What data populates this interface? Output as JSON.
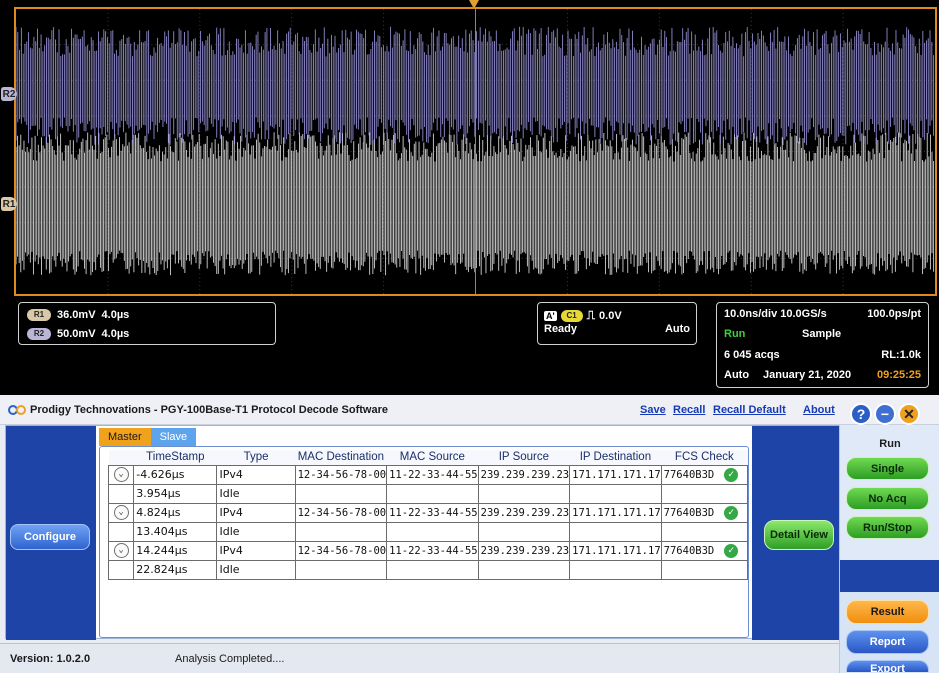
{
  "scope": {
    "markers": {
      "r2": "R2",
      "r1": "R1"
    },
    "channels": [
      {
        "tag": "R1",
        "scale": "36.0mV",
        "time": "4.0µs",
        "color": "#d9c9a8"
      },
      {
        "tag": "R2",
        "scale": "50.0mV",
        "time": "4.0µs",
        "color": "#b9b6d6"
      }
    ],
    "trigger": {
      "source_tag": "A'",
      "channel": "C1",
      "level": "0.0V",
      "state": "Ready",
      "mode": "Auto"
    },
    "acquisition": {
      "horizontal": "10.0ns/div 10.0GS/s",
      "per_point": "100.0ps/pt",
      "run_state": "Run",
      "sample_mode": "Sample",
      "acqs": "6 045 acqs",
      "record_length": "RL:1.0k",
      "trigger_mode": "Auto",
      "date": "January 21, 2020",
      "time": "09:25:25"
    },
    "colors": {
      "frame": "#e08a1e",
      "r1_wave": "#e8e8e8",
      "r2_wave": "#a9a3f2",
      "run": "#3cd23c",
      "time": "#f0a020"
    }
  },
  "app": {
    "title": "Prodigy Technovations - PGY-100Base-T1  Protocol Decode Software",
    "links": {
      "save": "Save",
      "recall": "Recall",
      "recall_default": "Recall Default",
      "about": "About"
    },
    "window_buttons": {
      "help": "?",
      "minimize": "−",
      "close": "✕"
    },
    "tabs": {
      "master": "Master",
      "slave": "Slave"
    },
    "buttons": {
      "configure": "Configure",
      "detail_view": "Detail View",
      "single": "Single",
      "no_acq": "No Acq",
      "run_stop": "Run/Stop",
      "result": "Result",
      "report": "Report",
      "export": "Export"
    },
    "run_label": "Run",
    "table": {
      "columns": [
        "",
        "TimeStamp",
        "Type",
        "MAC Destination",
        "MAC Source",
        "IP Source",
        "IP Destination",
        "FCS Check"
      ],
      "rows": [
        {
          "expand": true,
          "timestamp": "-4.626µs",
          "type": "IPv4",
          "mac_dst": "12-34-56-78-00",
          "mac_src": "11-22-33-44-55",
          "ip_src": "239.239.239.23",
          "ip_dst": "171.171.171.17",
          "fcs": "77640B3D",
          "fcs_ok": true
        },
        {
          "expand": false,
          "timestamp": "3.954µs",
          "type": "Idle",
          "mac_dst": "",
          "mac_src": "",
          "ip_src": "",
          "ip_dst": "",
          "fcs": "",
          "fcs_ok": false
        },
        {
          "expand": true,
          "timestamp": "4.824µs",
          "type": "IPv4",
          "mac_dst": "12-34-56-78-00",
          "mac_src": "11-22-33-44-55",
          "ip_src": "239.239.239.23",
          "ip_dst": "171.171.171.17",
          "fcs": "77640B3D",
          "fcs_ok": true
        },
        {
          "expand": false,
          "timestamp": "13.404µs",
          "type": "Idle",
          "mac_dst": "",
          "mac_src": "",
          "ip_src": "",
          "ip_dst": "",
          "fcs": "",
          "fcs_ok": false
        },
        {
          "expand": true,
          "timestamp": "14.244µs",
          "type": "IPv4",
          "mac_dst": "12-34-56-78-00",
          "mac_src": "11-22-33-44-55",
          "ip_src": "239.239.239.23",
          "ip_dst": "171.171.171.17",
          "fcs": "77640B3D",
          "fcs_ok": true
        },
        {
          "expand": false,
          "timestamp": "22.824µs",
          "type": "Idle",
          "mac_dst": "",
          "mac_src": "",
          "ip_src": "",
          "ip_dst": "",
          "fcs": "",
          "fcs_ok": false
        }
      ]
    },
    "status": {
      "version": "Version: 1.0.2.0",
      "message": "Analysis Completed...."
    }
  }
}
